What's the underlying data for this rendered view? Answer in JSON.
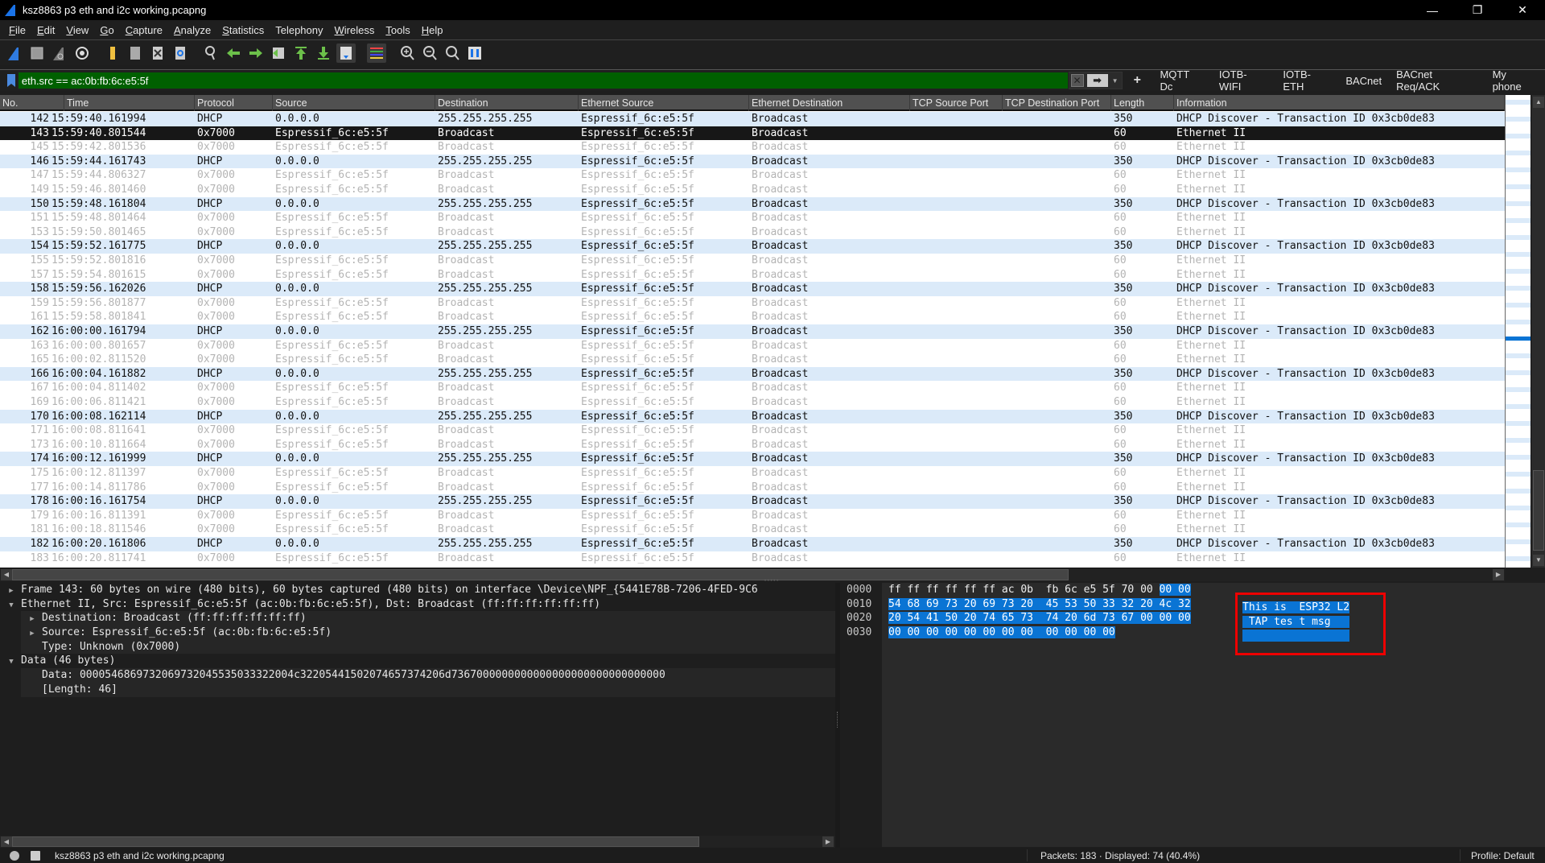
{
  "window": {
    "title": "ksz8863 p3 eth and i2c working.pcapng",
    "controls": {
      "minimize": "—",
      "restore": "❐",
      "close": "✕"
    }
  },
  "menu": [
    {
      "label": "File",
      "accel": "F",
      "rest": "ile"
    },
    {
      "label": "Edit",
      "accel": "E",
      "rest": "dit"
    },
    {
      "label": "View",
      "accel": "V",
      "rest": "iew"
    },
    {
      "label": "Go",
      "accel": "G",
      "rest": "o"
    },
    {
      "label": "Capture",
      "accel": "C",
      "rest": "apture"
    },
    {
      "label": "Analyze",
      "accel": "A",
      "rest": "nalyze"
    },
    {
      "label": "Statistics",
      "accel": "S",
      "rest": "tatistics"
    },
    {
      "label": "Telephony",
      "accel": "",
      "rest": "Telephony"
    },
    {
      "label": "Wireless",
      "accel": "W",
      "rest": "ireless"
    },
    {
      "label": "Tools",
      "accel": "T",
      "rest": "ools"
    },
    {
      "label": "Help",
      "accel": "H",
      "rest": "elp"
    }
  ],
  "toolbar": [
    "start-capture-icon",
    "stop-capture-icon",
    "restart-capture-icon",
    "capture-options-icon",
    "open-file-icon",
    "file-set-icon",
    "close-file-icon",
    "reload-file-icon",
    "find-packet-icon",
    "go-back-icon",
    "go-forward-icon",
    "go-to-packet-icon",
    "go-first-icon",
    "go-last-icon",
    "autoscroll-icon",
    "colorize-icon",
    "zoom-in-icon",
    "zoom-out-icon",
    "normal-size-icon",
    "resize-columns-icon"
  ],
  "filter": {
    "value": "eth.src == ac:0b:fb:6c:e5:5f",
    "clear_label": "✕",
    "apply_label": "➡",
    "dropdown_label": "▼",
    "add_label": "+",
    "bg_color": "#006000"
  },
  "filter_buttons": [
    "MQTT Dc",
    "IOTB-WIFI",
    "IOTB-ETH",
    "BACnet",
    "BACnet Req/ACK",
    "My phone"
  ],
  "columns": [
    "No.",
    "Time",
    "Protocol",
    "Source",
    "Destination",
    "Ethernet Source",
    "Ethernet Destination",
    "TCP Source Port",
    "TCP Destination Port",
    "Length",
    "Information"
  ],
  "colors": {
    "dhcp_row": "#dbeaf9",
    "eth_row_text": "#b4b4b4",
    "selected_row": "#171717",
    "highlight": "#0a74d4",
    "annotation": "#e00000"
  },
  "packets": [
    {
      "no": "142",
      "time": "15:59:40.161994",
      "proto": "DHCP",
      "src": "0.0.0.0",
      "dst": "255.255.255.255",
      "esrc": "Espressif_6c:e5:5f",
      "edst": "Broadcast",
      "sport": "",
      "dport": "",
      "len": "350",
      "info": "DHCP Discover - Transaction ID 0x3cb0de83",
      "type": "dhcp"
    },
    {
      "no": "143",
      "time": "15:59:40.801544",
      "proto": "0x7000",
      "src": "Espressif_6c:e5:5f",
      "dst": "Broadcast",
      "esrc": "Espressif_6c:e5:5f",
      "edst": "Broadcast",
      "sport": "",
      "dport": "",
      "len": "60",
      "info": "Ethernet II",
      "type": "sel"
    },
    {
      "no": "145",
      "time": "15:59:42.801536",
      "proto": "0x7000",
      "src": "Espressif_6c:e5:5f",
      "dst": "Broadcast",
      "esrc": "Espressif_6c:e5:5f",
      "edst": "Broadcast",
      "sport": "",
      "dport": "",
      "len": "60",
      "info": "Ethernet II",
      "type": "eth"
    },
    {
      "no": "146",
      "time": "15:59:44.161743",
      "proto": "DHCP",
      "src": "0.0.0.0",
      "dst": "255.255.255.255",
      "esrc": "Espressif_6c:e5:5f",
      "edst": "Broadcast",
      "sport": "",
      "dport": "",
      "len": "350",
      "info": "DHCP Discover - Transaction ID 0x3cb0de83",
      "type": "dhcp"
    },
    {
      "no": "147",
      "time": "15:59:44.806327",
      "proto": "0x7000",
      "src": "Espressif_6c:e5:5f",
      "dst": "Broadcast",
      "esrc": "Espressif_6c:e5:5f",
      "edst": "Broadcast",
      "sport": "",
      "dport": "",
      "len": "60",
      "info": "Ethernet II",
      "type": "eth"
    },
    {
      "no": "149",
      "time": "15:59:46.801460",
      "proto": "0x7000",
      "src": "Espressif_6c:e5:5f",
      "dst": "Broadcast",
      "esrc": "Espressif_6c:e5:5f",
      "edst": "Broadcast",
      "sport": "",
      "dport": "",
      "len": "60",
      "info": "Ethernet II",
      "type": "eth"
    },
    {
      "no": "150",
      "time": "15:59:48.161804",
      "proto": "DHCP",
      "src": "0.0.0.0",
      "dst": "255.255.255.255",
      "esrc": "Espressif_6c:e5:5f",
      "edst": "Broadcast",
      "sport": "",
      "dport": "",
      "len": "350",
      "info": "DHCP Discover - Transaction ID 0x3cb0de83",
      "type": "dhcp"
    },
    {
      "no": "151",
      "time": "15:59:48.801464",
      "proto": "0x7000",
      "src": "Espressif_6c:e5:5f",
      "dst": "Broadcast",
      "esrc": "Espressif_6c:e5:5f",
      "edst": "Broadcast",
      "sport": "",
      "dport": "",
      "len": "60",
      "info": "Ethernet II",
      "type": "eth"
    },
    {
      "no": "153",
      "time": "15:59:50.801465",
      "proto": "0x7000",
      "src": "Espressif_6c:e5:5f",
      "dst": "Broadcast",
      "esrc": "Espressif_6c:e5:5f",
      "edst": "Broadcast",
      "sport": "",
      "dport": "",
      "len": "60",
      "info": "Ethernet II",
      "type": "eth"
    },
    {
      "no": "154",
      "time": "15:59:52.161775",
      "proto": "DHCP",
      "src": "0.0.0.0",
      "dst": "255.255.255.255",
      "esrc": "Espressif_6c:e5:5f",
      "edst": "Broadcast",
      "sport": "",
      "dport": "",
      "len": "350",
      "info": "DHCP Discover - Transaction ID 0x3cb0de83",
      "type": "dhcp"
    },
    {
      "no": "155",
      "time": "15:59:52.801816",
      "proto": "0x7000",
      "src": "Espressif_6c:e5:5f",
      "dst": "Broadcast",
      "esrc": "Espressif_6c:e5:5f",
      "edst": "Broadcast",
      "sport": "",
      "dport": "",
      "len": "60",
      "info": "Ethernet II",
      "type": "eth"
    },
    {
      "no": "157",
      "time": "15:59:54.801615",
      "proto": "0x7000",
      "src": "Espressif_6c:e5:5f",
      "dst": "Broadcast",
      "esrc": "Espressif_6c:e5:5f",
      "edst": "Broadcast",
      "sport": "",
      "dport": "",
      "len": "60",
      "info": "Ethernet II",
      "type": "eth"
    },
    {
      "no": "158",
      "time": "15:59:56.162026",
      "proto": "DHCP",
      "src": "0.0.0.0",
      "dst": "255.255.255.255",
      "esrc": "Espressif_6c:e5:5f",
      "edst": "Broadcast",
      "sport": "",
      "dport": "",
      "len": "350",
      "info": "DHCP Discover - Transaction ID 0x3cb0de83",
      "type": "dhcp"
    },
    {
      "no": "159",
      "time": "15:59:56.801877",
      "proto": "0x7000",
      "src": "Espressif_6c:e5:5f",
      "dst": "Broadcast",
      "esrc": "Espressif_6c:e5:5f",
      "edst": "Broadcast",
      "sport": "",
      "dport": "",
      "len": "60",
      "info": "Ethernet II",
      "type": "eth"
    },
    {
      "no": "161",
      "time": "15:59:58.801841",
      "proto": "0x7000",
      "src": "Espressif_6c:e5:5f",
      "dst": "Broadcast",
      "esrc": "Espressif_6c:e5:5f",
      "edst": "Broadcast",
      "sport": "",
      "dport": "",
      "len": "60",
      "info": "Ethernet II",
      "type": "eth"
    },
    {
      "no": "162",
      "time": "16:00:00.161794",
      "proto": "DHCP",
      "src": "0.0.0.0",
      "dst": "255.255.255.255",
      "esrc": "Espressif_6c:e5:5f",
      "edst": "Broadcast",
      "sport": "",
      "dport": "",
      "len": "350",
      "info": "DHCP Discover - Transaction ID 0x3cb0de83",
      "type": "dhcp"
    },
    {
      "no": "163",
      "time": "16:00:00.801657",
      "proto": "0x7000",
      "src": "Espressif_6c:e5:5f",
      "dst": "Broadcast",
      "esrc": "Espressif_6c:e5:5f",
      "edst": "Broadcast",
      "sport": "",
      "dport": "",
      "len": "60",
      "info": "Ethernet II",
      "type": "eth"
    },
    {
      "no": "165",
      "time": "16:00:02.811520",
      "proto": "0x7000",
      "src": "Espressif_6c:e5:5f",
      "dst": "Broadcast",
      "esrc": "Espressif_6c:e5:5f",
      "edst": "Broadcast",
      "sport": "",
      "dport": "",
      "len": "60",
      "info": "Ethernet II",
      "type": "eth"
    },
    {
      "no": "166",
      "time": "16:00:04.161882",
      "proto": "DHCP",
      "src": "0.0.0.0",
      "dst": "255.255.255.255",
      "esrc": "Espressif_6c:e5:5f",
      "edst": "Broadcast",
      "sport": "",
      "dport": "",
      "len": "350",
      "info": "DHCP Discover - Transaction ID 0x3cb0de83",
      "type": "dhcp"
    },
    {
      "no": "167",
      "time": "16:00:04.811402",
      "proto": "0x7000",
      "src": "Espressif_6c:e5:5f",
      "dst": "Broadcast",
      "esrc": "Espressif_6c:e5:5f",
      "edst": "Broadcast",
      "sport": "",
      "dport": "",
      "len": "60",
      "info": "Ethernet II",
      "type": "eth"
    },
    {
      "no": "169",
      "time": "16:00:06.811421",
      "proto": "0x7000",
      "src": "Espressif_6c:e5:5f",
      "dst": "Broadcast",
      "esrc": "Espressif_6c:e5:5f",
      "edst": "Broadcast",
      "sport": "",
      "dport": "",
      "len": "60",
      "info": "Ethernet II",
      "type": "eth"
    },
    {
      "no": "170",
      "time": "16:00:08.162114",
      "proto": "DHCP",
      "src": "0.0.0.0",
      "dst": "255.255.255.255",
      "esrc": "Espressif_6c:e5:5f",
      "edst": "Broadcast",
      "sport": "",
      "dport": "",
      "len": "350",
      "info": "DHCP Discover - Transaction ID 0x3cb0de83",
      "type": "dhcp"
    },
    {
      "no": "171",
      "time": "16:00:08.811641",
      "proto": "0x7000",
      "src": "Espressif_6c:e5:5f",
      "dst": "Broadcast",
      "esrc": "Espressif_6c:e5:5f",
      "edst": "Broadcast",
      "sport": "",
      "dport": "",
      "len": "60",
      "info": "Ethernet II",
      "type": "eth"
    },
    {
      "no": "173",
      "time": "16:00:10.811664",
      "proto": "0x7000",
      "src": "Espressif_6c:e5:5f",
      "dst": "Broadcast",
      "esrc": "Espressif_6c:e5:5f",
      "edst": "Broadcast",
      "sport": "",
      "dport": "",
      "len": "60",
      "info": "Ethernet II",
      "type": "eth"
    },
    {
      "no": "174",
      "time": "16:00:12.161999",
      "proto": "DHCP",
      "src": "0.0.0.0",
      "dst": "255.255.255.255",
      "esrc": "Espressif_6c:e5:5f",
      "edst": "Broadcast",
      "sport": "",
      "dport": "",
      "len": "350",
      "info": "DHCP Discover - Transaction ID 0x3cb0de83",
      "type": "dhcp"
    },
    {
      "no": "175",
      "time": "16:00:12.811397",
      "proto": "0x7000",
      "src": "Espressif_6c:e5:5f",
      "dst": "Broadcast",
      "esrc": "Espressif_6c:e5:5f",
      "edst": "Broadcast",
      "sport": "",
      "dport": "",
      "len": "60",
      "info": "Ethernet II",
      "type": "eth"
    },
    {
      "no": "177",
      "time": "16:00:14.811786",
      "proto": "0x7000",
      "src": "Espressif_6c:e5:5f",
      "dst": "Broadcast",
      "esrc": "Espressif_6c:e5:5f",
      "edst": "Broadcast",
      "sport": "",
      "dport": "",
      "len": "60",
      "info": "Ethernet II",
      "type": "eth"
    },
    {
      "no": "178",
      "time": "16:00:16.161754",
      "proto": "DHCP",
      "src": "0.0.0.0",
      "dst": "255.255.255.255",
      "esrc": "Espressif_6c:e5:5f",
      "edst": "Broadcast",
      "sport": "",
      "dport": "",
      "len": "350",
      "info": "DHCP Discover - Transaction ID 0x3cb0de83",
      "type": "dhcp"
    },
    {
      "no": "179",
      "time": "16:00:16.811391",
      "proto": "0x7000",
      "src": "Espressif_6c:e5:5f",
      "dst": "Broadcast",
      "esrc": "Espressif_6c:e5:5f",
      "edst": "Broadcast",
      "sport": "",
      "dport": "",
      "len": "60",
      "info": "Ethernet II",
      "type": "eth"
    },
    {
      "no": "181",
      "time": "16:00:18.811546",
      "proto": "0x7000",
      "src": "Espressif_6c:e5:5f",
      "dst": "Broadcast",
      "esrc": "Espressif_6c:e5:5f",
      "edst": "Broadcast",
      "sport": "",
      "dport": "",
      "len": "60",
      "info": "Ethernet II",
      "type": "eth"
    },
    {
      "no": "182",
      "time": "16:00:20.161806",
      "proto": "DHCP",
      "src": "0.0.0.0",
      "dst": "255.255.255.255",
      "esrc": "Espressif_6c:e5:5f",
      "edst": "Broadcast",
      "sport": "",
      "dport": "",
      "len": "350",
      "info": "DHCP Discover - Transaction ID 0x3cb0de83",
      "type": "dhcp"
    },
    {
      "no": "183",
      "time": "16:00:20.811741",
      "proto": "0x7000",
      "src": "Espressif_6c:e5:5f",
      "dst": "Broadcast",
      "esrc": "Espressif_6c:e5:5f",
      "edst": "Broadcast",
      "sport": "",
      "dport": "",
      "len": "60",
      "info": "Ethernet II",
      "type": "eth"
    }
  ],
  "details": [
    {
      "text": "Frame 143: 60 bytes on wire (480 bits), 60 bytes captured (480 bits) on interface \\Device\\NPF_{5441E78B-7206-4FED-9C6",
      "level": 0,
      "toggle": "collapsed"
    },
    {
      "text": "Ethernet II, Src: Espressif_6c:e5:5f (ac:0b:fb:6c:e5:5f), Dst: Broadcast (ff:ff:ff:ff:ff:ff)",
      "level": 0,
      "toggle": "expanded"
    },
    {
      "text": "Destination: Broadcast (ff:ff:ff:ff:ff:ff)",
      "level": 1,
      "toggle": "collapsed"
    },
    {
      "text": "Source: Espressif_6c:e5:5f (ac:0b:fb:6c:e5:5f)",
      "level": 1,
      "toggle": "collapsed"
    },
    {
      "text": "Type: Unknown (0x7000)",
      "level": 1,
      "toggle": "none"
    },
    {
      "text": "Data (46 bytes)",
      "level": 0,
      "toggle": "expanded"
    },
    {
      "text": "Data: 0000546869732069732045535033322004c32205441502074657374206d7367000000000000000000000000000000",
      "level": 1,
      "toggle": "none"
    },
    {
      "text": "[Length: 46]",
      "level": 1,
      "toggle": "none"
    }
  ],
  "hex": {
    "offsets": [
      "0000",
      "0010",
      "0020",
      "0030"
    ],
    "lines": [
      {
        "plain": "ff ff ff ff ff ff ac 0b  fb 6c e5 5f 70 00 ",
        "hl": "00 00"
      },
      {
        "plain": "",
        "hl": "54 68 69 73 20 69 73 20  45 53 50 33 32 20 4c 32"
      },
      {
        "plain": "",
        "hl": "20 54 41 50 20 74 65 73  74 20 6d 73 67 00 00 00"
      },
      {
        "plain": "",
        "hl": "00 00 00 00 00 00 00 00  00 00 00 00"
      }
    ],
    "ascii": [
      "This is  ESP32 L2",
      " TAP tes t msg   ",
      "                 "
    ]
  },
  "status": {
    "file": "ksz8863 p3 eth and i2c working.pcapng",
    "packets": "Packets: 183 · Displayed: 74 (40.4%)",
    "profile": "Profile: Default"
  }
}
